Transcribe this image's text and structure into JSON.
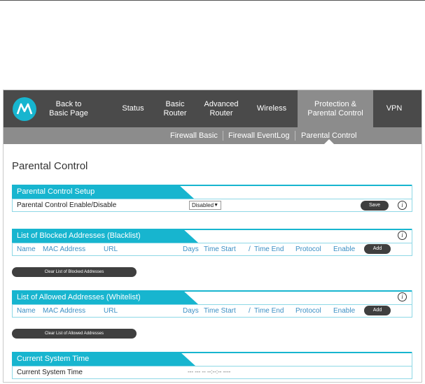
{
  "nav": {
    "items": [
      {
        "label": "Back to\nBasic Page"
      },
      {
        "label": "Status"
      },
      {
        "label": "Basic\nRouter"
      },
      {
        "label": "Advanced\nRouter"
      },
      {
        "label": "Wireless"
      },
      {
        "label": "Protection &\nParental Control"
      },
      {
        "label": "VPN"
      }
    ]
  },
  "subnav": {
    "items": [
      {
        "label": "Firewall Basic"
      },
      {
        "label": "Firewall EventLog"
      },
      {
        "label": "Parental Control"
      }
    ]
  },
  "page": {
    "title": "Parental Control"
  },
  "setup": {
    "title": "Parental Control Setup",
    "row_label": "Parental Control Enable/Disable",
    "select_value": "Disabled",
    "select_arrow": "▼",
    "save_label": "Save",
    "info_glyph": "i"
  },
  "columns": {
    "name": "Name",
    "mac": "MAC Address",
    "url": "URL",
    "days": "Days",
    "time_start": "Time Start",
    "slash": "/",
    "time_end": "Time End",
    "protocol": "Protocol",
    "enable": "Enable"
  },
  "blocked": {
    "title": "List of Blocked Addresses (Blacklist)",
    "add_label": "Add",
    "clear_label": "Clear List of Blocked Addresses",
    "info_glyph": "i"
  },
  "allowed": {
    "title": "List of Allowed Addresses (Whitelist)",
    "add_label": "Add",
    "clear_label": "Clear List of Allowed Addresses",
    "info_glyph": "i"
  },
  "time": {
    "title": "Current System Time",
    "row_label": "Current System Time",
    "value": "--- --- -- --:--:-- ----"
  },
  "colors": {
    "accent": "#17b5cf",
    "nav_bg": "#4a4a4a",
    "subnav_bg": "#8c8c8c",
    "column_text": "#3c8fc4"
  },
  "icons": {
    "logo": "motorola-logo-icon"
  }
}
